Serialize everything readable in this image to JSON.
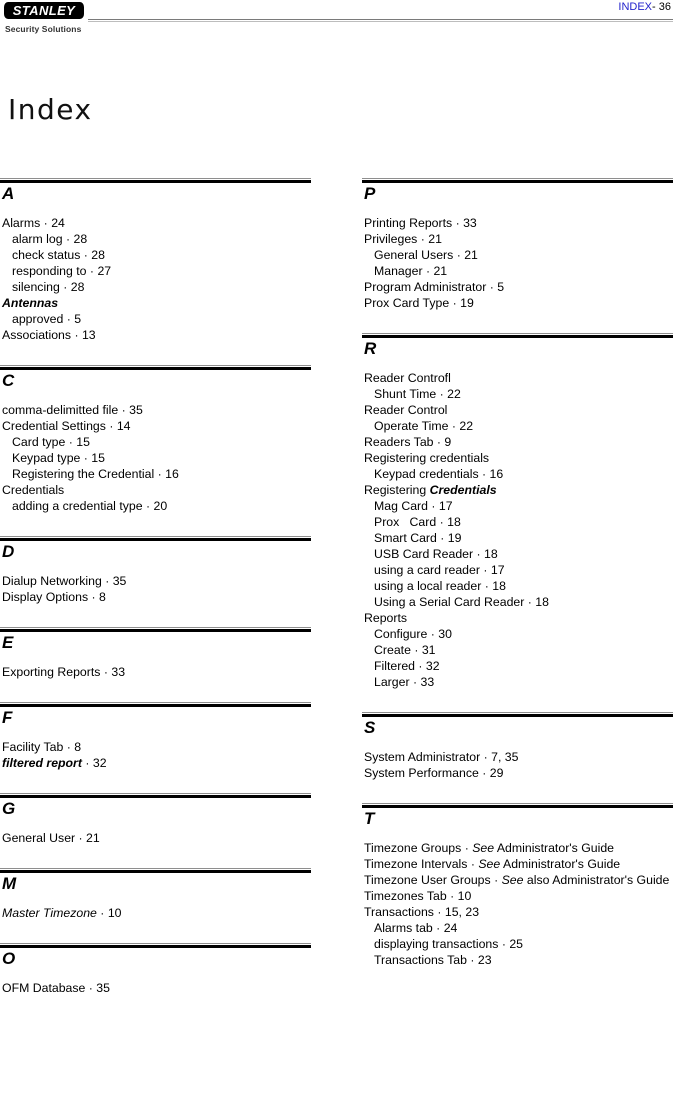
{
  "header": {
    "logo_word": "STANLEY",
    "logo_tagline": "Security Solutions",
    "folio_label": "INDEX",
    "folio_number": "- 36"
  },
  "title": "Index",
  "columns": {
    "left": [
      {
        "letter": "A",
        "entries": [
          {
            "level": 0,
            "html": "Alarms · 24"
          },
          {
            "level": 1,
            "html": "alarm log · 28"
          },
          {
            "level": 1,
            "html": "check status · 28"
          },
          {
            "level": 1,
            "html": "responding to · 27"
          },
          {
            "level": 1,
            "html": "silencing · 28"
          },
          {
            "level": 0,
            "html": "<span class='bi'>Antennas</span>"
          },
          {
            "level": 1,
            "html": "approved · 5"
          },
          {
            "level": 0,
            "html": "Associations · 13"
          }
        ]
      },
      {
        "letter": "C",
        "entries": [
          {
            "level": 0,
            "html": "comma-delimitted file · 35"
          },
          {
            "level": 0,
            "html": "Credential Settings · 14"
          },
          {
            "level": 1,
            "html": "Card type · 15"
          },
          {
            "level": 1,
            "html": "Keypad type · 15"
          },
          {
            "level": 1,
            "html": "Registering the Credential · 16"
          },
          {
            "level": 0,
            "html": "Credentials"
          },
          {
            "level": 1,
            "html": "adding a credential type · 20"
          }
        ]
      },
      {
        "letter": "D",
        "entries": [
          {
            "level": 0,
            "html": "Dialup Networking · 35"
          },
          {
            "level": 0,
            "html": "Display Options · 8"
          }
        ]
      },
      {
        "letter": "E",
        "entries": [
          {
            "level": 0,
            "html": "Exporting Reports · 33"
          }
        ]
      },
      {
        "letter": "F",
        "entries": [
          {
            "level": 0,
            "html": "Facility Tab · 8"
          },
          {
            "level": 0,
            "html": "<span class='bi'>filtered report</span> · 32"
          }
        ]
      },
      {
        "letter": "G",
        "entries": [
          {
            "level": 0,
            "html": "General User · 21"
          }
        ]
      },
      {
        "letter": "M",
        "entries": [
          {
            "level": 0,
            "html": "<span class='it'>Master Timezone</span> · 10"
          }
        ]
      },
      {
        "letter": "O",
        "entries": [
          {
            "level": 0,
            "html": "OFM Database · 35"
          }
        ]
      }
    ],
    "right": [
      {
        "letter": "P",
        "entries": [
          {
            "level": 0,
            "html": "Printing Reports · 33"
          },
          {
            "level": 0,
            "html": "Privileges · 21"
          },
          {
            "level": 1,
            "html": "General Users · 21"
          },
          {
            "level": 1,
            "html": "Manager · 21"
          },
          {
            "level": 0,
            "html": "Program Administrator · 5"
          },
          {
            "level": 0,
            "html": "Prox Card Type · 19"
          }
        ]
      },
      {
        "letter": "R",
        "entries": [
          {
            "level": 0,
            "html": "Reader Controfl"
          },
          {
            "level": 1,
            "html": "Shunt Time · 22"
          },
          {
            "level": 0,
            "html": "Reader Control"
          },
          {
            "level": 1,
            "html": "Operate Time · 22"
          },
          {
            "level": 0,
            "html": "Readers Tab · 9"
          },
          {
            "level": 0,
            "html": "Registering credentials"
          },
          {
            "level": 1,
            "html": "Keypad credentials · 16"
          },
          {
            "level": 0,
            "html": "Registering <span class='bi'>Credentials</span>"
          },
          {
            "level": 1,
            "html": "Mag Card · 17"
          },
          {
            "level": 1,
            "html": "Prox&nbsp;&nbsp; Card · 18"
          },
          {
            "level": 1,
            "html": "Smart Card · 19"
          },
          {
            "level": 1,
            "html": "USB Card Reader · 18"
          },
          {
            "level": 1,
            "html": "using a card reader · 17"
          },
          {
            "level": 1,
            "html": "using a local reader · 18"
          },
          {
            "level": 1,
            "html": "Using a Serial Card Reader · 18"
          },
          {
            "level": 0,
            "html": "Reports"
          },
          {
            "level": 1,
            "html": "Configure · 30"
          },
          {
            "level": 1,
            "html": "Create · 31"
          },
          {
            "level": 1,
            "html": "Filtered · 32"
          },
          {
            "level": 1,
            "html": "Larger · 33"
          }
        ]
      },
      {
        "letter": "S",
        "entries": [
          {
            "level": 0,
            "html": "System Administrator · 7, 35"
          },
          {
            "level": 0,
            "html": "System Performance · 29"
          }
        ]
      },
      {
        "letter": "T",
        "entries": [
          {
            "level": 0,
            "html": "Timezone Groups · <span class='it'>See</span> Administrator's Guide"
          },
          {
            "level": 0,
            "html": "Timezone Intervals · <span class='it'>See</span> Administrator's Guide"
          },
          {
            "level": 0,
            "html": "Timezone User Groups · <span class='it'>See</span> also Administrator's Guide"
          },
          {
            "level": 0,
            "html": "Timezones Tab · 10"
          },
          {
            "level": 0,
            "html": "Transactions · 15, 23"
          },
          {
            "level": 1,
            "html": "Alarms tab · 24"
          },
          {
            "level": 1,
            "html": "displaying transactions · 25"
          },
          {
            "level": 1,
            "html": "Transactions Tab · 23"
          }
        ]
      }
    ]
  },
  "colors": {
    "folio_label": "#2222cc",
    "rule": "#000000",
    "text": "#000000"
  }
}
